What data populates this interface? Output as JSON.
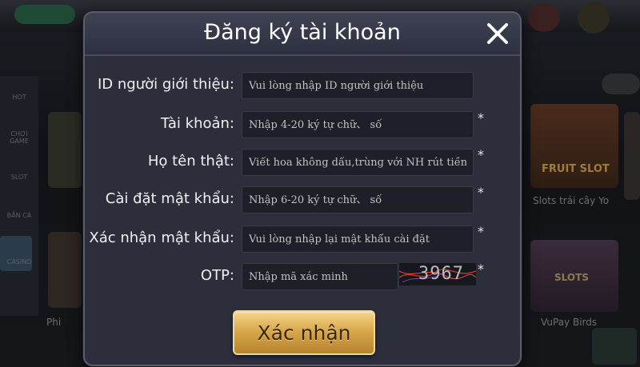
{
  "dialog": {
    "title": "Đăng ký tài khoản",
    "fields": [
      {
        "label": "ID người giới thiệu:",
        "placeholder": "Vui lòng nhập ID người giới thiệu",
        "required": ""
      },
      {
        "label": "Tài khoản:",
        "placeholder": "Nhập 4-20 ký tự chữ、 số",
        "required": "*"
      },
      {
        "label": "Họ tên thật:",
        "placeholder": "Viết hoa không dấu,trùng với NH rút tiền",
        "required": "*"
      },
      {
        "label": "Cài đặt mật khẩu:",
        "placeholder": "Nhập 6-20 ký tự chữ、 số",
        "required": "*"
      },
      {
        "label": "Xác nhận mật khẩu:",
        "placeholder": "Vui lòng nhập lại mật khẩu cài đặt",
        "required": "*"
      }
    ],
    "otp": {
      "label": "OTP:",
      "placeholder": "Nhập mã xác minh",
      "captcha_text": "3967",
      "required": "*"
    },
    "submit_label": "Xác nhận"
  },
  "background": {
    "sidebar": [
      "HOT",
      "CHƠI\nGAME",
      "SLOT",
      "BẮN\nCÁ",
      "CASINO"
    ],
    "captions": [
      "Slots trái cây Yo",
      "VuPay Birds",
      "Phi"
    ],
    "card_text": [
      "FRUIT SLOT",
      "SLOTS"
    ]
  },
  "colors": {
    "dialog_bg": "#2c2f3b",
    "field_bg": "#1d2028",
    "button_gold": "#d9a94c"
  }
}
